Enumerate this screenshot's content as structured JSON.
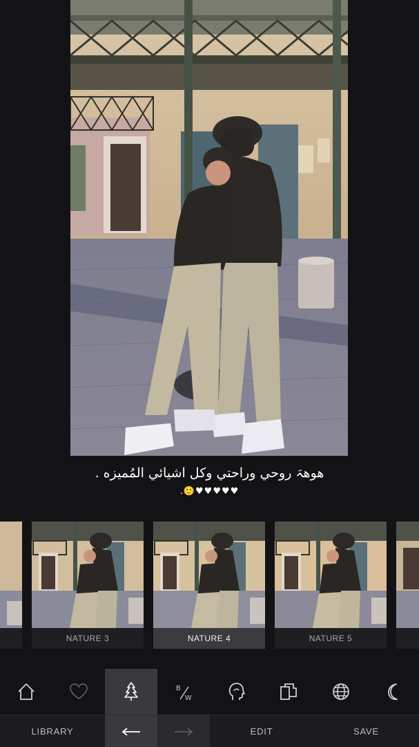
{
  "caption": {
    "line1": "هوهہَ روحي وراحتي وكل اشيائي المُميزه .",
    "line2": ".🙂♥♥♥♥♥"
  },
  "filters": [
    {
      "label": ""
    },
    {
      "label": "NATURE 3"
    },
    {
      "label": "NATURE 4",
      "selected": true
    },
    {
      "label": "NATURE 5"
    },
    {
      "label": ""
    }
  ],
  "toolbar": {
    "tools": [
      "home-icon",
      "heart-icon",
      "tree-icon",
      "bw-icon",
      "head-icon",
      "layers-icon",
      "globe-icon",
      "moon-icon"
    ],
    "active": "tree-icon"
  },
  "bottom": {
    "library": "LIBRARY",
    "edit": "EDIT",
    "save": "SAVE"
  }
}
